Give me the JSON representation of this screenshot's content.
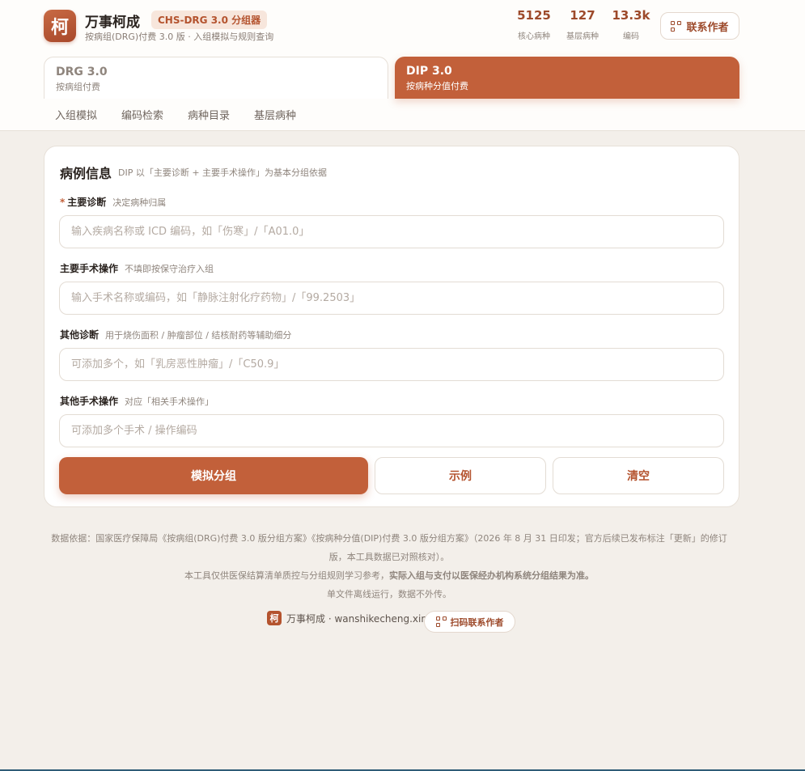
{
  "brand": {
    "logo_char": "柯",
    "name": "万事柯成",
    "badge": "CHS-DRG 3.0 分组器",
    "subtitle": "按病组(DRG)付费 3.0 版 · 入组模拟与规则查询"
  },
  "stats": [
    {
      "value": "5125",
      "label": "核心病种"
    },
    {
      "value": "127",
      "label": "基层病种"
    },
    {
      "value": "13.3k",
      "label": "编码"
    }
  ],
  "contact_label": "联系作者",
  "mode_tabs": [
    {
      "title": "DRG 3.0",
      "subtitle": "按病组付费",
      "active": false
    },
    {
      "title": "DIP 3.0",
      "subtitle": "按病种分值付费",
      "active": true
    }
  ],
  "subnav": [
    "入组模拟",
    "编码检索",
    "病种目录",
    "基层病种"
  ],
  "case": {
    "title": "病例信息",
    "subtitle": "DIP 以「主要诊断 + 主要手术操作」为基本分组依据",
    "fields": [
      {
        "required": "*",
        "label": "主要诊断",
        "hint": "决定病种归属",
        "placeholder": "输入疾病名称或 ICD 编码，如「伤寒」/「A01.0」"
      },
      {
        "required": "",
        "label": "主要手术操作",
        "hint": "不填即按保守治疗入组",
        "placeholder": "输入手术名称或编码，如「静脉注射化疗药物」/「99.2503」"
      },
      {
        "required": "",
        "label": "其他诊断",
        "hint": "用于烧伤面积 / 肿瘤部位 / 结核耐药等辅助细分",
        "placeholder": "可添加多个，如「乳房恶性肿瘤」/「C50.9」"
      },
      {
        "required": "",
        "label": "其他手术操作",
        "hint": "对应「相关手术操作」",
        "placeholder": "可添加多个手术 / 操作编码"
      }
    ],
    "buttons": {
      "simulate": "模拟分组",
      "example": "示例",
      "clear": "清空"
    }
  },
  "footer": {
    "line1": "数据依据：国家医疗保障局《按病组(DRG)付费 3.0 版分组方案》《按病种分值(DIP)付费 3.0 版分组方案》（2026 年 8 月 31 日印发；官方后续已发布标注「更新」的修订版，本工具数据已对照核对）。",
    "line2a": "本工具仅供医保结算清单质控与分组规则学习参考，",
    "line2b": "实际入组与支付以医保经办机构系统分组结果为准。",
    "line3": "单文件离线运行，数据不外传。",
    "brand_char": "柯",
    "site": "万事柯成 · wanshikecheng.xin",
    "scan_label": "扫码联系作者"
  }
}
